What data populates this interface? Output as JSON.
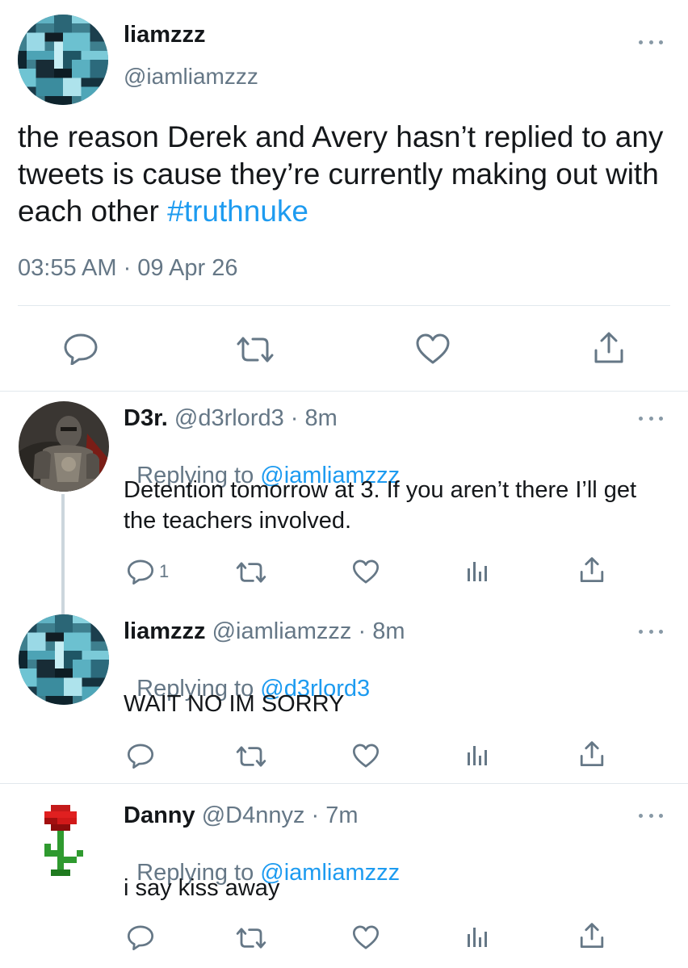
{
  "main_tweet": {
    "author_name": "liamzzz",
    "author_handle": "@iamliamzzz",
    "text": "the reason Derek and Avery hasn’t replied to any tweets is cause they’re currently making out with each other ",
    "hashtag": "#truthnuke",
    "timestamp": "03:55 AM · 09 Apr 26",
    "actions": [
      "reply-icon",
      "retweet-icon",
      "like-icon",
      "share-icon"
    ]
  },
  "replies": [
    {
      "author_name": "D3r.",
      "author_handle": "@d3rlord3",
      "time": "8m",
      "replying_prefix": "Replying to ",
      "replying_to": "@iamliamzzz",
      "text": "Detention tomorrow at 3. If you aren’t there I’ll get the teachers involved.",
      "reply_count": "1"
    },
    {
      "author_name": "liamzzz",
      "author_handle": "@iamliamzzz",
      "time": "8m",
      "replying_prefix": "Replying to ",
      "replying_to": "@d3rlord3",
      "text": "WAIT NO IM SORRY",
      "reply_count": ""
    },
    {
      "author_name": "Danny",
      "author_handle": "@D4nnyz",
      "time": "7m",
      "replying_prefix": "Replying to ",
      "replying_to": "@iamliamzzz",
      "text": "i say kiss away",
      "reply_count": ""
    }
  ],
  "separator": " · ",
  "colors": {
    "link": "#1d9bf0",
    "muted": "#657786",
    "divider": "#e1e8ed"
  }
}
